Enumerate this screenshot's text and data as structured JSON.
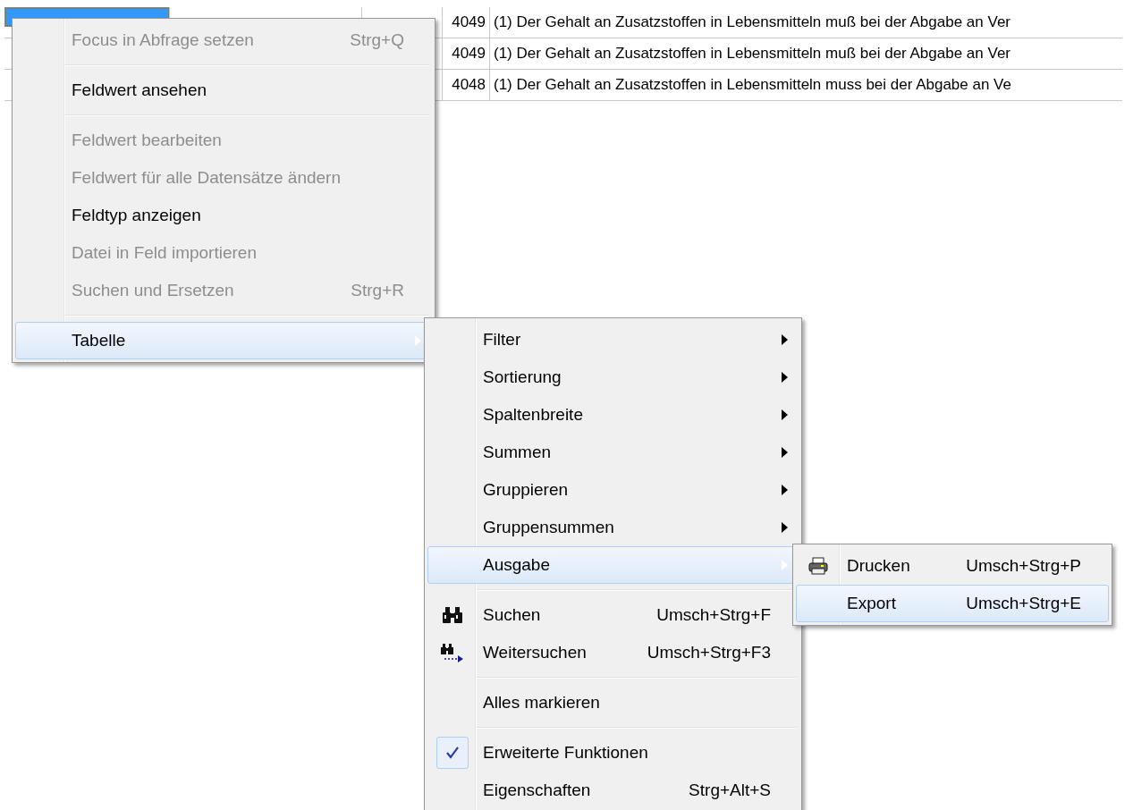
{
  "table": {
    "rows": [
      {
        "selected": true,
        "number": "4049",
        "text": "(1) Der Gehalt an Zusatzstoffen in Lebensmitteln muß bei der Abgabe an Ver"
      },
      {
        "selected": false,
        "number": "4049",
        "text": "(1) Der Gehalt an Zusatzstoffen in Lebensmitteln muß bei der Abgabe an Ver"
      },
      {
        "selected": false,
        "number": "4048",
        "text": "(1) Der Gehalt an Zusatzstoffen in Lebensmitteln muss bei der Abgabe an Ve"
      }
    ]
  },
  "context_menu": {
    "items": [
      {
        "kind": "item",
        "label": "Focus in Abfrage setzen",
        "shortcut": "Strg+Q",
        "disabled": true,
        "selected": false
      },
      {
        "kind": "separator"
      },
      {
        "kind": "item",
        "label": "Feldwert ansehen",
        "disabled": false,
        "selected": false
      },
      {
        "kind": "separator"
      },
      {
        "kind": "item",
        "label": "Feldwert bearbeiten",
        "disabled": true,
        "selected": false
      },
      {
        "kind": "item",
        "label": "Feldwert für alle Datensätze ändern",
        "disabled": true,
        "selected": false
      },
      {
        "kind": "item",
        "label": "Feldtyp anzeigen",
        "disabled": false,
        "selected": false
      },
      {
        "kind": "item",
        "label": "Datei in Feld importieren",
        "disabled": true,
        "selected": false
      },
      {
        "kind": "item",
        "label": "Suchen und Ersetzen",
        "shortcut": "Strg+R",
        "disabled": true,
        "selected": false
      },
      {
        "kind": "separator"
      },
      {
        "kind": "item",
        "label": "Tabelle",
        "has_submenu": true,
        "disabled": false,
        "selected": true
      }
    ]
  },
  "table_submenu": {
    "items": [
      {
        "kind": "item",
        "label": "Filter",
        "has_submenu": true,
        "disabled": false,
        "selected": false
      },
      {
        "kind": "item",
        "label": "Sortierung",
        "has_submenu": true,
        "disabled": false,
        "selected": false
      },
      {
        "kind": "item",
        "label": "Spaltenbreite",
        "has_submenu": true,
        "disabled": false,
        "selected": false
      },
      {
        "kind": "item",
        "label": "Summen",
        "has_submenu": true,
        "disabled": false,
        "selected": false
      },
      {
        "kind": "item",
        "label": "Gruppieren",
        "has_submenu": true,
        "disabled": false,
        "selected": false
      },
      {
        "kind": "item",
        "label": "Gruppensummen",
        "has_submenu": true,
        "disabled": false,
        "selected": false
      },
      {
        "kind": "item",
        "label": "Ausgabe",
        "has_submenu": true,
        "disabled": false,
        "selected": true
      },
      {
        "kind": "separator"
      },
      {
        "kind": "search",
        "label": "Suchen",
        "shortcut": "Umsch+Strg+F",
        "disabled": false,
        "selected": false
      },
      {
        "kind": "findnext",
        "label": "Weitersuchen",
        "shortcut": "Umsch+Strg+F3",
        "disabled": false,
        "selected": false
      },
      {
        "kind": "separator"
      },
      {
        "kind": "item",
        "label": "Alles markieren",
        "disabled": false,
        "selected": false
      },
      {
        "kind": "separator"
      },
      {
        "kind": "item",
        "label": "Erweiterte Funktionen",
        "checked": true,
        "disabled": false,
        "selected": false
      },
      {
        "kind": "item",
        "label": "Eigenschaften",
        "shortcut": "Strg+Alt+S",
        "disabled": false,
        "selected": false
      }
    ]
  },
  "output_submenu": {
    "items": [
      {
        "kind": "print",
        "label": "Drucken",
        "shortcut": "Umsch+Strg+P",
        "disabled": false,
        "selected": false
      },
      {
        "kind": "item",
        "label": "Export",
        "shortcut": "Umsch+Strg+E",
        "disabled": false,
        "selected": true
      }
    ]
  }
}
